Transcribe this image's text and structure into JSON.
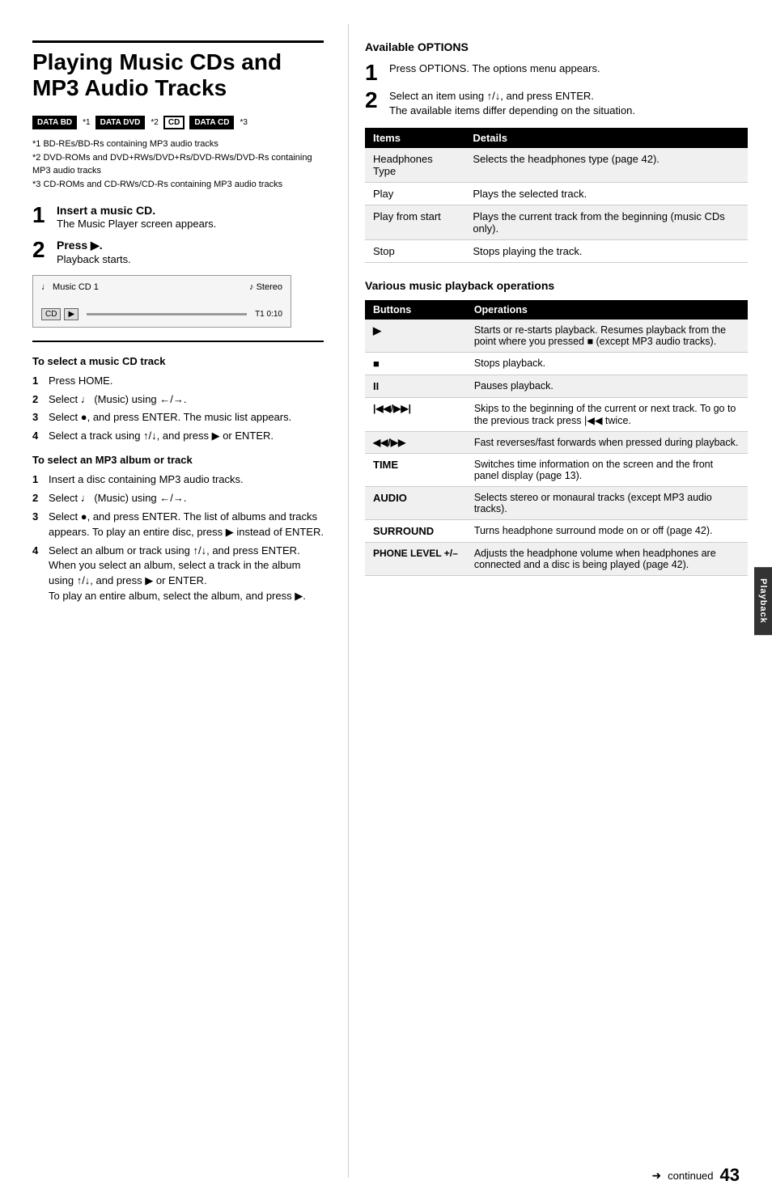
{
  "page": {
    "title_line1": "Playing Music CDs and",
    "title_line2": "MP3 Audio Tracks",
    "page_number": "43",
    "continued_text": "continued",
    "tab_label": "Playback"
  },
  "badges": [
    {
      "label": "DATA BD",
      "style": "filled"
    },
    {
      "sup": "*1"
    },
    {
      "label": "DATA DVD",
      "style": "filled"
    },
    {
      "sup": "*2"
    },
    {
      "label": "CD",
      "style": "outline"
    },
    {
      "label": "DATA CD",
      "style": "filled"
    },
    {
      "sup": "*3"
    }
  ],
  "footnotes": [
    "*1 BD-REs/BD-Rs containing MP3 audio tracks",
    "*2 DVD-ROMs and DVD+RWs/DVD+Rs/DVD-RWs/DVD-Rs containing MP3 audio tracks",
    "*3 CD-ROMs and CD-RWs/CD-Rs containing MP3 audio tracks"
  ],
  "main_steps": [
    {
      "num": "1",
      "title": "Insert a music CD.",
      "desc": "The Music Player screen appears."
    },
    {
      "num": "2",
      "title": "Press ▶.",
      "desc": "Playback starts."
    }
  ],
  "player": {
    "label": "♩ Music CD  1",
    "stereo": "♪ Stereo",
    "btn_cd": "CD",
    "btn_play": "▶",
    "time": "T1  0:10"
  },
  "select_cd_track": {
    "title": "To select a music CD track",
    "steps": [
      {
        "num": "1",
        "text": "Press HOME."
      },
      {
        "num": "2",
        "text": "Select ♩ (Music) using ←/→."
      },
      {
        "num": "3",
        "text": "Select ●, and press ENTER. The music list appears."
      },
      {
        "num": "4",
        "text": "Select a track using ↑/↓, and press ▶ or ENTER."
      }
    ]
  },
  "select_mp3": {
    "title": "To select an MP3 album or track",
    "steps": [
      {
        "num": "1",
        "text": "Insert a disc containing MP3 audio tracks."
      },
      {
        "num": "2",
        "text": "Select ♩ (Music) using ←/→."
      },
      {
        "num": "3",
        "text": "Select ●, and press ENTER. The list of albums and tracks appears. To play an entire disc, press ▶ instead of ENTER."
      },
      {
        "num": "4",
        "text": "Select an album or track using ↑/↓, and press ENTER.\nWhen you select an album, select a track in the album using ↑/↓, and press ▶ or ENTER.\nTo play an entire album, select the album, and press ▶."
      }
    ]
  },
  "available_options": {
    "title": "Available OPTIONS",
    "intro_steps": [
      {
        "num": "1",
        "text": "Press OPTIONS. The options menu appears."
      },
      {
        "num": "2",
        "text": "Select an item using ↑/↓, and press ENTER. The available items differ depending on the situation."
      }
    ],
    "table": {
      "headers": [
        "Items",
        "Details"
      ],
      "rows": [
        {
          "item": "Headphones Type",
          "detail": "Selects the headphones type (page 42)."
        },
        {
          "item": "Play",
          "detail": "Plays the selected track."
        },
        {
          "item": "Play from start",
          "detail": "Plays the current track from the beginning (music CDs only)."
        },
        {
          "item": "Stop",
          "detail": "Stops playing the track."
        }
      ]
    }
  },
  "various_operations": {
    "title": "Various music playback operations",
    "table": {
      "headers": [
        "Buttons",
        "Operations"
      ],
      "rows": [
        {
          "btn": "▶",
          "op": "Starts or re-starts playback. Resumes playback from the point where you pressed ■ (except MP3 audio tracks)."
        },
        {
          "btn": "■",
          "op": "Stops playback."
        },
        {
          "btn": "II",
          "op": "Pauses playback."
        },
        {
          "btn": "◀◀/▶▶|",
          "op": "Skips to the beginning of the current or next track. To go to the previous track press ◀◀ twice."
        },
        {
          "btn": "◀◀/▶▶",
          "op": "Fast reverses/fast forwards when pressed during playback."
        },
        {
          "btn": "TIME",
          "op": "Switches time information on the screen and the front panel display (page 13)."
        },
        {
          "btn": "AUDIO",
          "op": "Selects stereo or monaural tracks (except MP3 audio tracks)."
        },
        {
          "btn": "SURROUND",
          "op": "Turns headphone surround mode on or off (page 42)."
        },
        {
          "btn": "PHONE LEVEL +/–",
          "op": "Adjusts the headphone volume when headphones are connected and a disc is being played (page 42)."
        }
      ]
    }
  }
}
